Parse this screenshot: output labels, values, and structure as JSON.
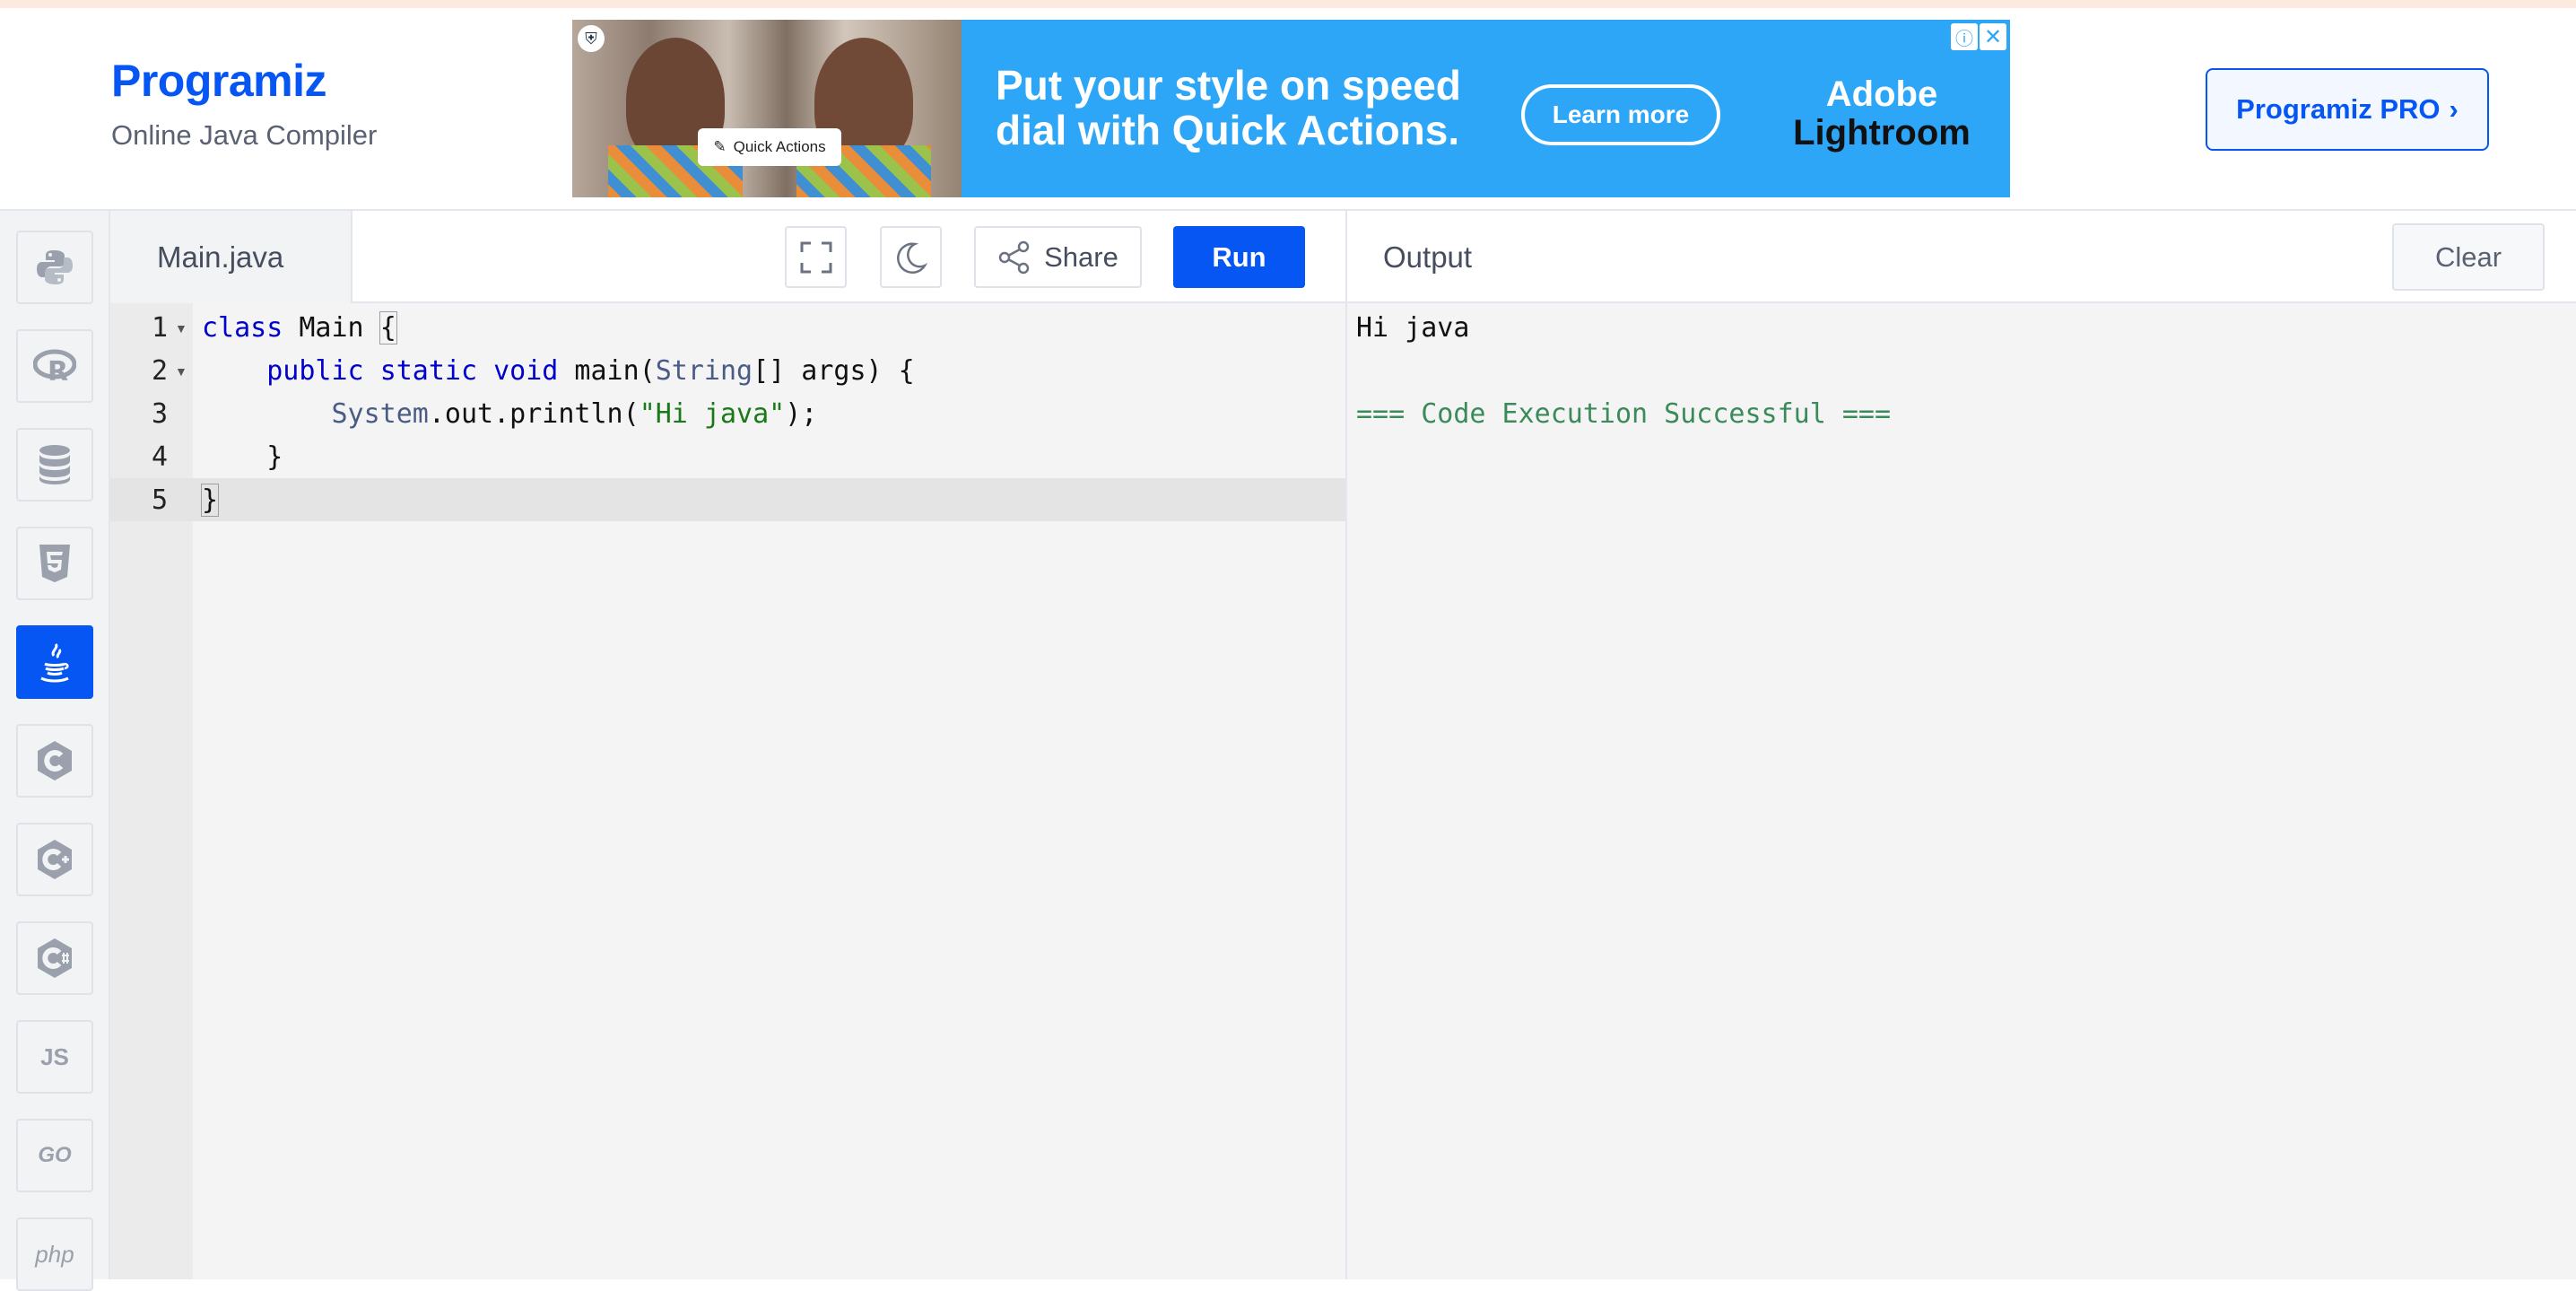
{
  "header": {
    "brand": "Programiz",
    "subtitle": "Online Java Compiler",
    "pro_button": "Programiz PRO",
    "pro_chevron": "›"
  },
  "ad": {
    "headline_line1": "Put your style on speed",
    "headline_line2": "dial with Quick Actions.",
    "cta": "Learn more",
    "brand_line1": "Adobe",
    "brand_line2": "Lightroom",
    "chip_label": "Quick Actions",
    "info_icon": "ⓘ",
    "close_icon": "✕"
  },
  "sidebar": {
    "languages": [
      {
        "name": "python",
        "glyph": "🐍"
      },
      {
        "name": "r",
        "glyph": "R"
      },
      {
        "name": "sql",
        "glyph": "⛁"
      },
      {
        "name": "html",
        "glyph": "5"
      },
      {
        "name": "java",
        "glyph": "☕"
      },
      {
        "name": "c",
        "glyph": "C"
      },
      {
        "name": "cpp",
        "glyph": "C+"
      },
      {
        "name": "csharp",
        "glyph": "C#"
      },
      {
        "name": "javascript",
        "glyph": "JS"
      },
      {
        "name": "go",
        "glyph": "GO"
      },
      {
        "name": "php",
        "glyph": "php"
      }
    ],
    "active": "java"
  },
  "editor": {
    "file_name": "Main.java",
    "share_label": "Share",
    "run_label": "Run",
    "line_numbers": [
      "1",
      "2",
      "3",
      "4",
      "5"
    ],
    "lines": [
      "class Main {",
      "    public static void main(String[] args) {",
      "        System.out.println(\"Hi java\");",
      "    }",
      "}"
    ],
    "active_line": 5
  },
  "output": {
    "title": "Output",
    "clear_label": "Clear",
    "lines": [
      "Hi java",
      "",
      "=== Code Execution Successful ==="
    ]
  },
  "colors": {
    "accent": "#0556f3",
    "ad_background": "#2ea6f7",
    "success_text": "#3b8a5a"
  }
}
